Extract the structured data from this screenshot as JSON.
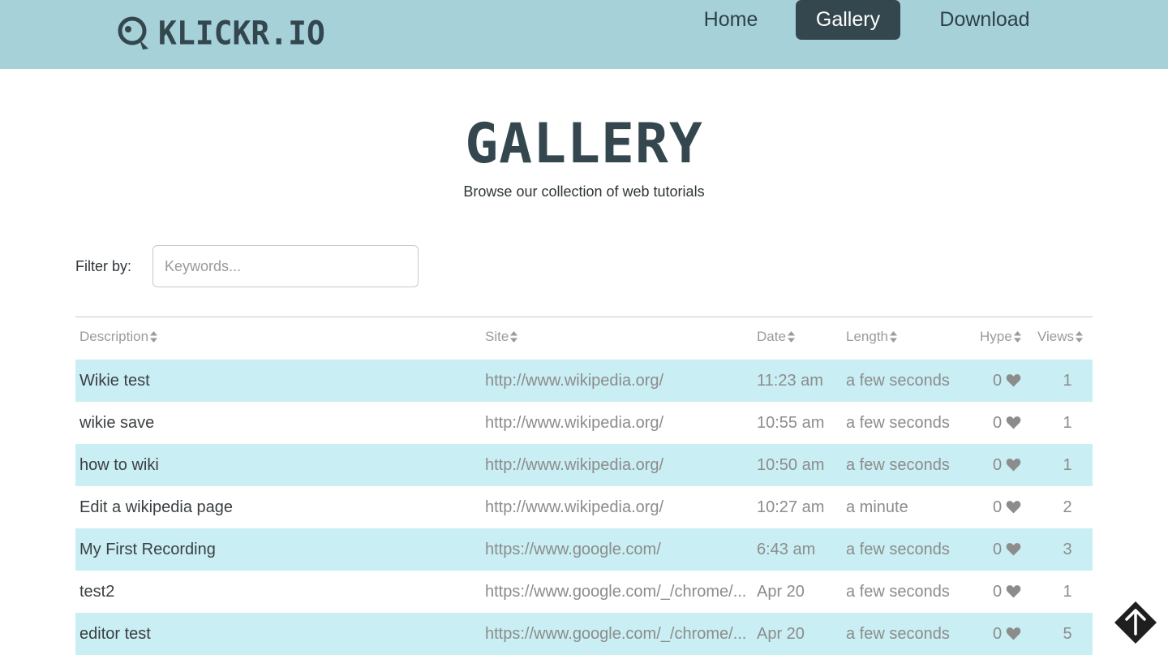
{
  "header": {
    "logo_text": "KLICKR.IO",
    "nav": [
      {
        "label": "Home",
        "active": false
      },
      {
        "label": "Gallery",
        "active": true
      },
      {
        "label": "Download",
        "active": false
      }
    ]
  },
  "page": {
    "title": "GALLERY",
    "subtitle": "Browse our collection of web tutorials"
  },
  "filter": {
    "label": "Filter by:",
    "placeholder": "Keywords...",
    "value": ""
  },
  "table": {
    "columns": [
      "Description",
      "Site",
      "Date",
      "Length",
      "Hype",
      "Views"
    ],
    "rows": [
      {
        "description": "Wikie test",
        "site": "http://www.wikipedia.org/",
        "date": "11:23 am",
        "length": "a few seconds",
        "hype": "0",
        "views": "1"
      },
      {
        "description": "wikie save",
        "site": "http://www.wikipedia.org/",
        "date": "10:55 am",
        "length": "a few seconds",
        "hype": "0",
        "views": "1"
      },
      {
        "description": "how to wiki",
        "site": "http://www.wikipedia.org/",
        "date": "10:50 am",
        "length": "a few seconds",
        "hype": "0",
        "views": "1"
      },
      {
        "description": "Edit a wikipedia page",
        "site": "http://www.wikipedia.org/",
        "date": "10:27 am",
        "length": "a minute",
        "hype": "0",
        "views": "2"
      },
      {
        "description": "My First Recording",
        "site": "https://www.google.com/",
        "date": "6:43 am",
        "length": "a few seconds",
        "hype": "0",
        "views": "3"
      },
      {
        "description": "test2",
        "site": "https://www.google.com/_/chrome/...",
        "date": "Apr 20",
        "length": "a few seconds",
        "hype": "0",
        "views": "1"
      },
      {
        "description": "editor test",
        "site": "https://www.google.com/_/chrome/...",
        "date": "Apr 20",
        "length": "a few seconds",
        "hype": "0",
        "views": "5"
      }
    ]
  },
  "icons": {
    "logo": "klickr-logo-icon",
    "sort": "sort-icon",
    "hype": "heart-icon",
    "scroll_top": "arrow-up-icon"
  },
  "colors": {
    "header_bg": "#a6d1d8",
    "brand_dark": "#34474e",
    "row_stripe": "#c9eef3",
    "muted_text": "#8c8c8c"
  }
}
